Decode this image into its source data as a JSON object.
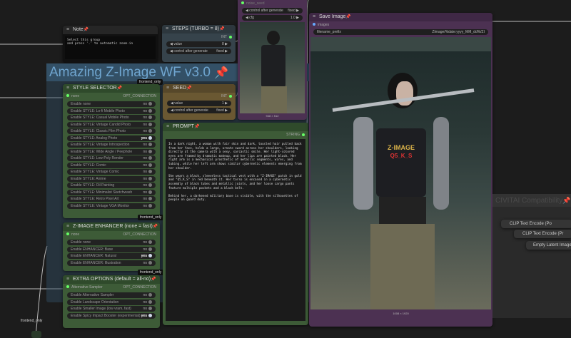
{
  "colors": {
    "canvas": "#1c1c1c",
    "group_blue": "#335066",
    "node_green": "#3d5b37",
    "node_purple": "#4c3152",
    "node_brown": "#6a5832",
    "node_slate": "#36434b"
  },
  "note": {
    "title": "Note",
    "text_line1": "Select this group",
    "text_line2": "and press '.' to automatic zoom-in"
  },
  "steps": {
    "title": "STEPS (TURBO = 8)",
    "output": "INT",
    "value_label": "value",
    "value": "8",
    "control_label": "control after generate",
    "control_value": "fixed"
  },
  "group": {
    "title": "Amazing Z-Image WF v3.0",
    "badge": "frontend_only"
  },
  "style_selector": {
    "title": "STYLE SELECTOR",
    "input": "none",
    "output": "OPT_CONNECTION",
    "badge": "frontend_only",
    "items": [
      {
        "label": "Enable none",
        "value": "no"
      },
      {
        "label": "Enable STYLE: Lo-fi Mobile Photo",
        "value": "no"
      },
      {
        "label": "Enable STYLE: Casual Mobile Photo",
        "value": "no"
      },
      {
        "label": "Enable STYLE: Vintage Candid Photo",
        "value": "no"
      },
      {
        "label": "Enable STYLE: Classic Film Photo",
        "value": "no"
      },
      {
        "label": "Enable STYLE: Analog Photo",
        "value": "yes"
      },
      {
        "label": "Enable STYLE: Vintage Introspection",
        "value": "no"
      },
      {
        "label": "Enable STYLE: Wide Angle / Peephole",
        "value": "no"
      },
      {
        "label": "Enable STYLE: Low-Poly Render",
        "value": "no"
      },
      {
        "label": "Enable STYLE: Comic",
        "value": "no"
      },
      {
        "label": "Enable STYLE: Vintage Comic",
        "value": "no"
      },
      {
        "label": "Enable STYLE: Anime",
        "value": "no"
      },
      {
        "label": "Enable STYLE: Oil Painting",
        "value": "no"
      },
      {
        "label": "Enable STYLE: Minimalist Sketchwash",
        "value": "no"
      },
      {
        "label": "Enable STYLE: Retro Pixel Art",
        "value": "no"
      },
      {
        "label": "Enable STYLE: Vintage VGA Monitor",
        "value": "no"
      }
    ]
  },
  "enhancer": {
    "title": "Z-IMAGE ENHANCER (none = fast)",
    "input": "none",
    "output": "OPT_CONNECTION",
    "badge": "frontend_only",
    "items": [
      {
        "label": "Enable none",
        "value": "no"
      },
      {
        "label": "Enable ENHANCER: Base",
        "value": "no"
      },
      {
        "label": "Enable ENHANCER: Natural",
        "value": "yes"
      },
      {
        "label": "Enable ENHANCER: Illustration",
        "value": "no"
      }
    ]
  },
  "extra": {
    "title": "EXTRA OPTIONS (default = all-no)",
    "input": "Alternative Sampler",
    "output": "OPT_CONNECTION",
    "items": [
      {
        "label": "Enable Alternative Sampler",
        "value": "no"
      },
      {
        "label": "Enable Landscape Orientation",
        "value": "no"
      },
      {
        "label": "Enable Smaller Image (low vram, fast)",
        "value": "no"
      },
      {
        "label": "Enable Spicy Impact Booster (experimental)",
        "value": "yes"
      }
    ]
  },
  "seed": {
    "title": "SEED",
    "output": "INT",
    "value_label": "value",
    "value": "1",
    "control_label": "control after generate",
    "control_value": "fixed"
  },
  "preview": {
    "input": "noise_seed",
    "control_label": "control after generate",
    "control_value": "fixed",
    "cfg_label": "cfg",
    "cfg_value": "1.0",
    "size": "948 × 512"
  },
  "prompt": {
    "title": "PROMPT",
    "output": "STRING",
    "p1": "In a dark night, a woman with fair skin and dark, tousled hair pulled back from her face, holds a large, ornate sword across her shoulders, looking directly at the camera with a sexy, sarcastic smile. Her light-colored eyes are framed by dramatic makeup, and her lips are painted black. Her right arm is a mechanical prosthetic of metallic segments, wires, and tubing, while her left arm shows similar cybernetic elements emerging from her shoulder.",
    "p2": "She wears a black, sleeveless tactical vest with a \"Z-IMAGE\" patch in gold and \"Q5_K_S\" in red beneath it. Her torso is encased in a cybernetic assembly of black tubes and metallic joints, and her loose cargo pants feature multiple pockets and a black belt.",
    "p3": "Behind her, a darkened military base is visible, with the silhouettes of people on guard duty."
  },
  "save": {
    "title": "Save Image",
    "input": "images",
    "prefix_label": "filename_prefix",
    "prefix_value": "ZImage/%date:yyyy_MM_dd%/ZI",
    "size": "1008 × 1920",
    "patch1": "Z-IMAGE",
    "patch2": "Q5_K_S"
  },
  "civitai": {
    "title": "CIVITAI Compatibility",
    "nodes": [
      "CLIP Text Encode (Po",
      "CLIP Text Encode (Pr",
      "Empty Latent Image"
    ]
  },
  "bottom_badge": "frontend_only"
}
